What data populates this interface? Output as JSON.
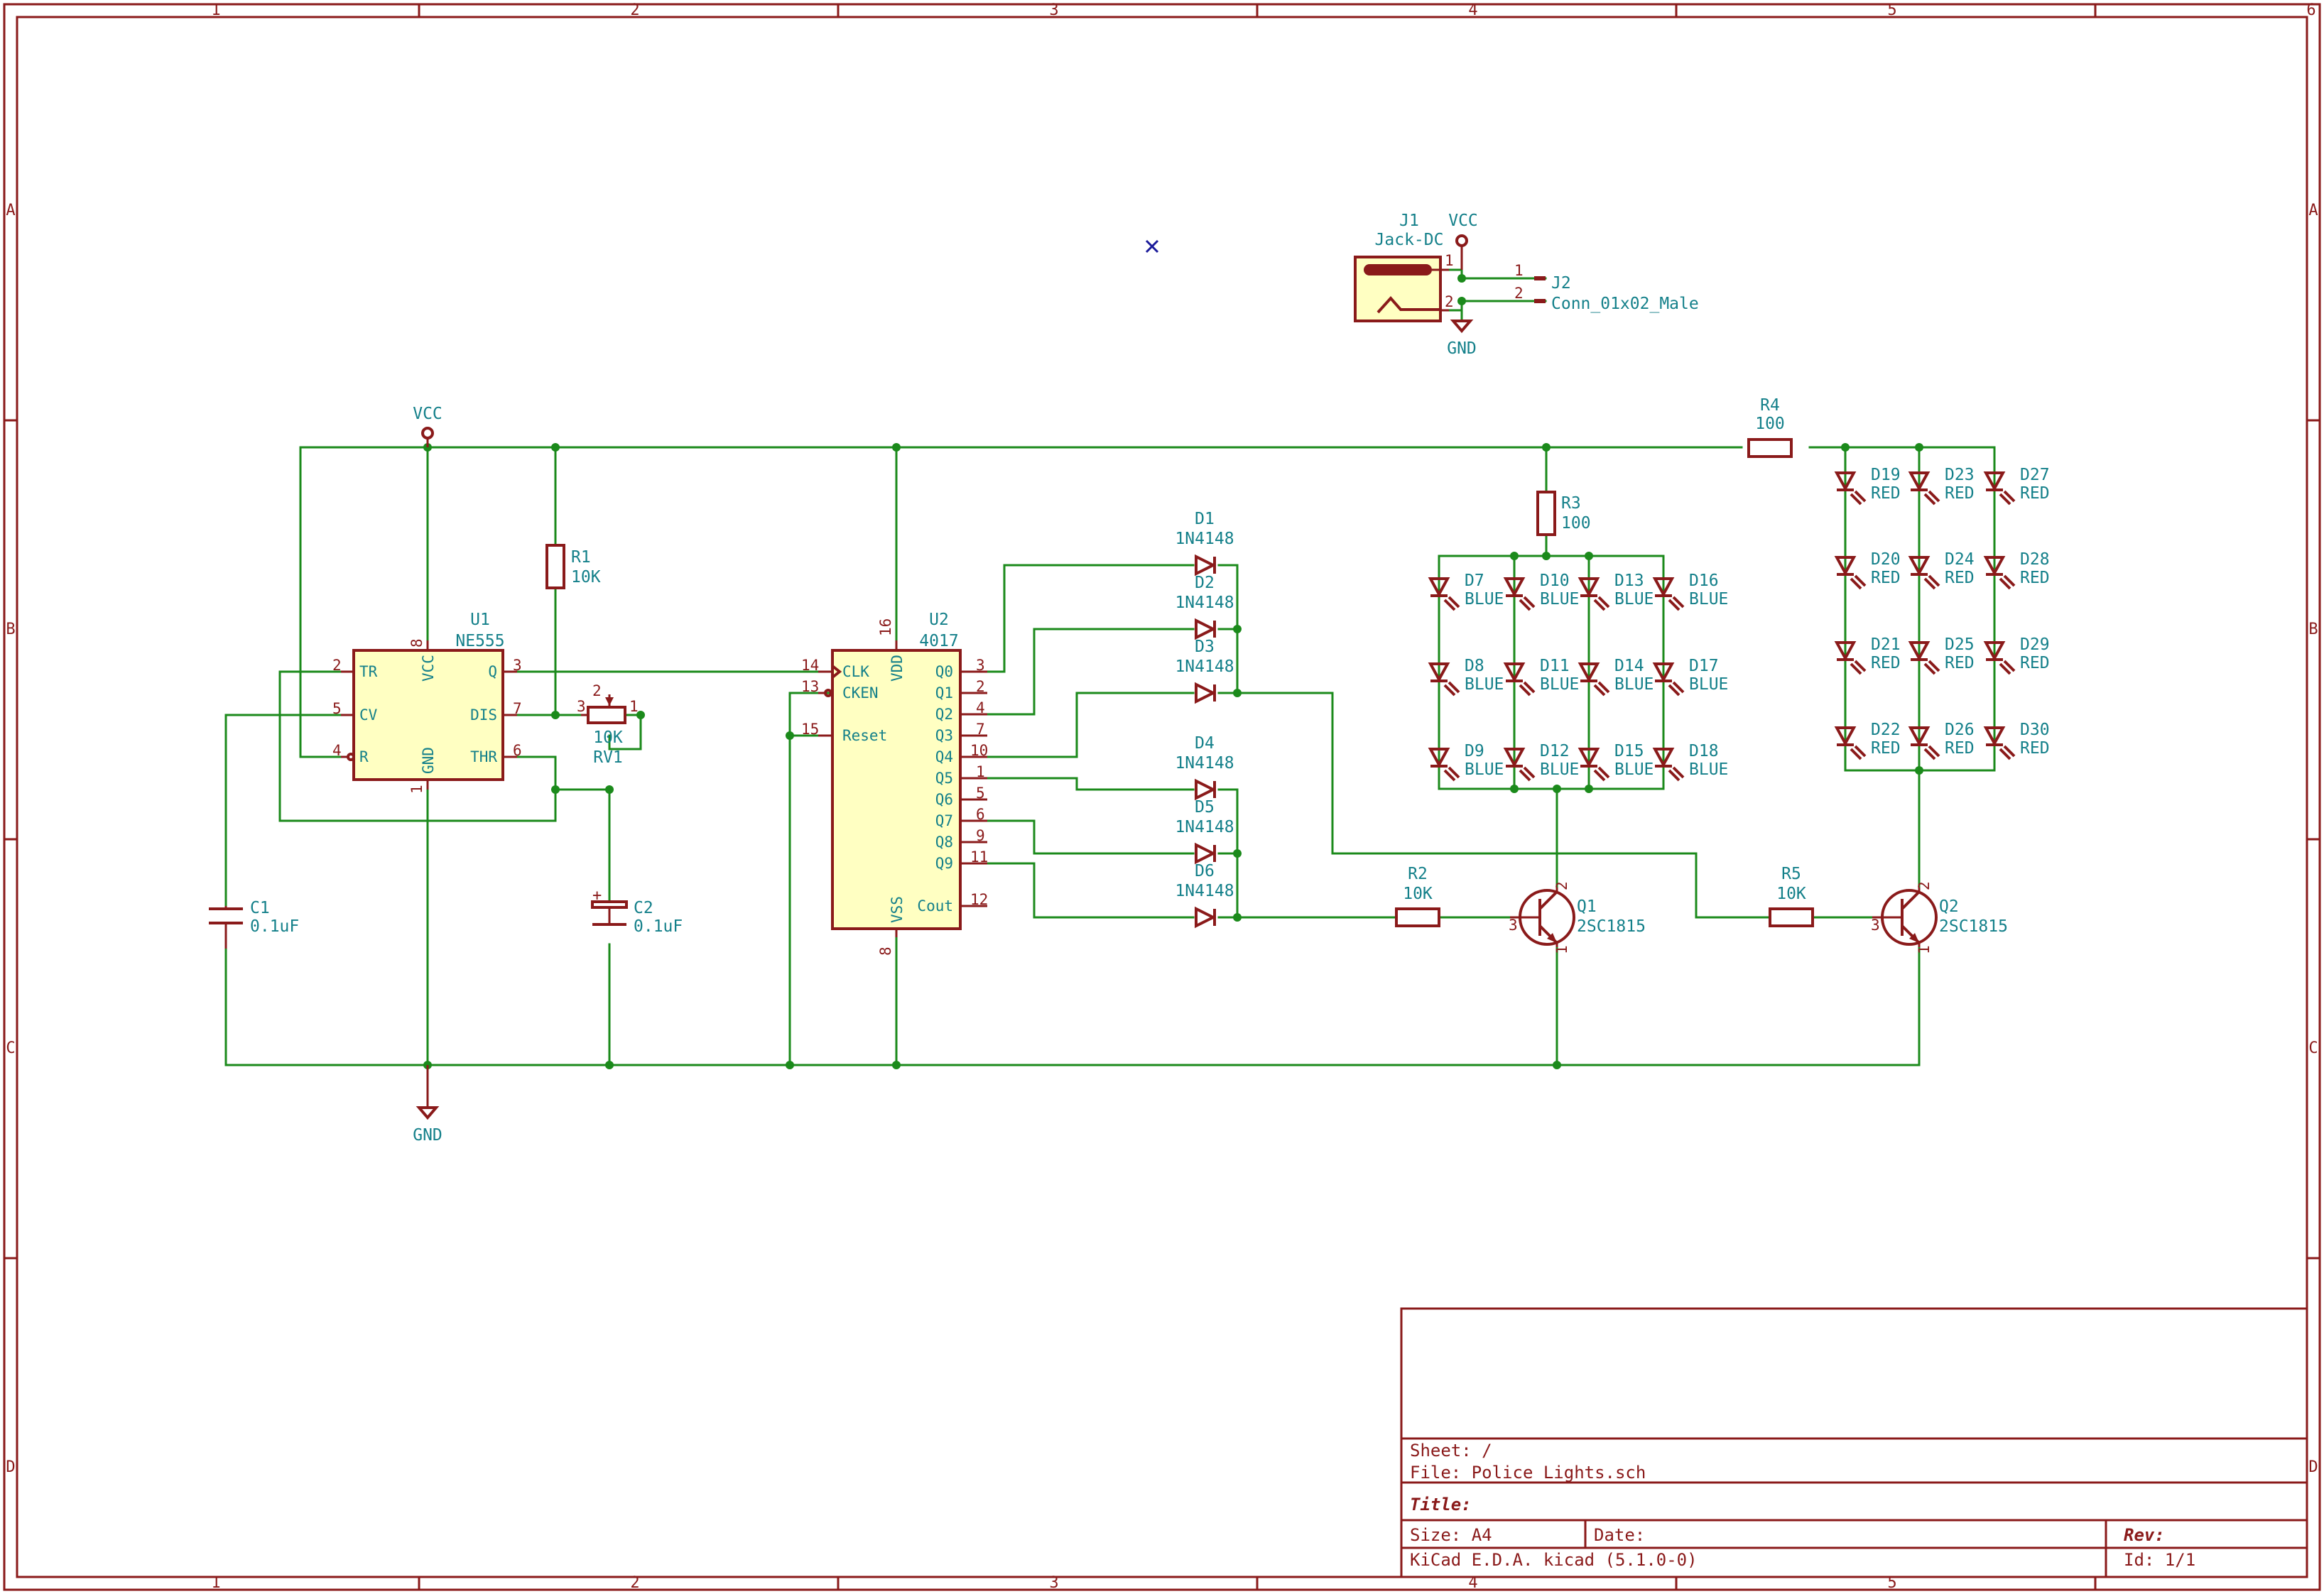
{
  "frame": {
    "columns": [
      "1",
      "2",
      "3",
      "4",
      "5",
      "6"
    ],
    "rows": [
      "A",
      "B",
      "C",
      "D"
    ]
  },
  "parts": {
    "J1": {
      "ref": "J1",
      "value": "Jack-DC"
    },
    "J2": {
      "ref": "J2",
      "value": "Conn_01x02_Male"
    },
    "U1": {
      "ref": "U1",
      "value": "NE555"
    },
    "U2": {
      "ref": "U2",
      "value": "4017"
    },
    "R1": {
      "ref": "R1",
      "value": "10K"
    },
    "R2": {
      "ref": "R2",
      "value": "10K"
    },
    "R3": {
      "ref": "R3",
      "value": "100"
    },
    "R4": {
      "ref": "R4",
      "value": "100"
    },
    "R5": {
      "ref": "R5",
      "value": "10K"
    },
    "RV1": {
      "ref": "RV1",
      "value": "10K"
    },
    "C1": {
      "ref": "C1",
      "value": "0.1uF"
    },
    "C2": {
      "ref": "C2",
      "value": "0.1uF"
    },
    "D1": {
      "ref": "D1",
      "value": "1N4148"
    },
    "D2": {
      "ref": "D2",
      "value": "1N4148"
    },
    "D3": {
      "ref": "D3",
      "value": "1N4148"
    },
    "D4": {
      "ref": "D4",
      "value": "1N4148"
    },
    "D5": {
      "ref": "D5",
      "value": "1N4148"
    },
    "D6": {
      "ref": "D6",
      "value": "1N4148"
    },
    "Q1": {
      "ref": "Q1",
      "value": "2SC1815"
    },
    "Q2": {
      "ref": "Q2",
      "value": "2SC1815"
    }
  },
  "power": {
    "vcc": "VCC",
    "gnd": "GND"
  },
  "u1_pins": {
    "tr": "TR",
    "cv": "CV",
    "r": "R",
    "vcc": "VCC",
    "gnd": "GND",
    "q": "Q",
    "dis": "DIS",
    "thr": "THR",
    "n2": "2",
    "n5": "5",
    "n4": "4",
    "n8": "8",
    "n1": "1",
    "n3": "3",
    "n7": "7",
    "n6": "6"
  },
  "u2_pins": {
    "clk": "CLK",
    "cken": "CKEN",
    "reset": "Reset",
    "vdd": "VDD",
    "vss": "VSS",
    "cout": "Cout",
    "q0": "Q0",
    "q1": "Q1",
    "q2": "Q2",
    "q3": "Q3",
    "q4": "Q4",
    "q5": "Q5",
    "q6": "Q6",
    "q7": "Q7",
    "q8": "Q8",
    "q9": "Q9",
    "n14": "14",
    "n13": "13",
    "n15": "15",
    "n16": "16",
    "n8": "8",
    "p3": "3",
    "p2": "2",
    "p4": "4",
    "p7": "7",
    "p10": "10",
    "p1": "1",
    "p5": "5",
    "p6": "6",
    "p9": "9",
    "p11": "11",
    "p12": "12"
  },
  "misc_pins": {
    "j1_1": "1",
    "j1_2": "2",
    "j2_1": "1",
    "j2_2": "2",
    "rv1_3": "3",
    "rv1_2": "2",
    "rv1_1": "1",
    "q_b": "3",
    "q_c": "2",
    "q_e": "1"
  },
  "blue_leds": [
    {
      "ref": "D7",
      "value": "BLUE"
    },
    {
      "ref": "D8",
      "value": "BLUE"
    },
    {
      "ref": "D9",
      "value": "BLUE"
    },
    {
      "ref": "D10",
      "value": "BLUE"
    },
    {
      "ref": "D11",
      "value": "BLUE"
    },
    {
      "ref": "D12",
      "value": "BLUE"
    },
    {
      "ref": "D13",
      "value": "BLUE"
    },
    {
      "ref": "D14",
      "value": "BLUE"
    },
    {
      "ref": "D15",
      "value": "BLUE"
    },
    {
      "ref": "D16",
      "value": "BLUE"
    },
    {
      "ref": "D17",
      "value": "BLUE"
    },
    {
      "ref": "D18",
      "value": "BLUE"
    }
  ],
  "red_leds": [
    {
      "ref": "D19",
      "value": "RED"
    },
    {
      "ref": "D20",
      "value": "RED"
    },
    {
      "ref": "D21",
      "value": "RED"
    },
    {
      "ref": "D22",
      "value": "RED"
    },
    {
      "ref": "D23",
      "value": "RED"
    },
    {
      "ref": "D24",
      "value": "RED"
    },
    {
      "ref": "D25",
      "value": "RED"
    },
    {
      "ref": "D26",
      "value": "RED"
    },
    {
      "ref": "D27",
      "value": "RED"
    },
    {
      "ref": "D28",
      "value": "RED"
    },
    {
      "ref": "D29",
      "value": "RED"
    },
    {
      "ref": "D30",
      "value": "RED"
    }
  ],
  "title_block": {
    "sheet": "Sheet: /",
    "file": "File: Police Lights.sch",
    "title": "Title:",
    "size": "Size: A4",
    "date": "Date:",
    "rev": "Rev:",
    "tool": "KiCad E.D.A.  kicad (5.1.0-0)",
    "id": "Id: 1/1"
  },
  "colors": {
    "border": "#8a1a1a",
    "wire": "#1b8a1b",
    "text": "#14808a",
    "body_fill": "#ffffc2",
    "no_connect": "#1a1a9a"
  }
}
